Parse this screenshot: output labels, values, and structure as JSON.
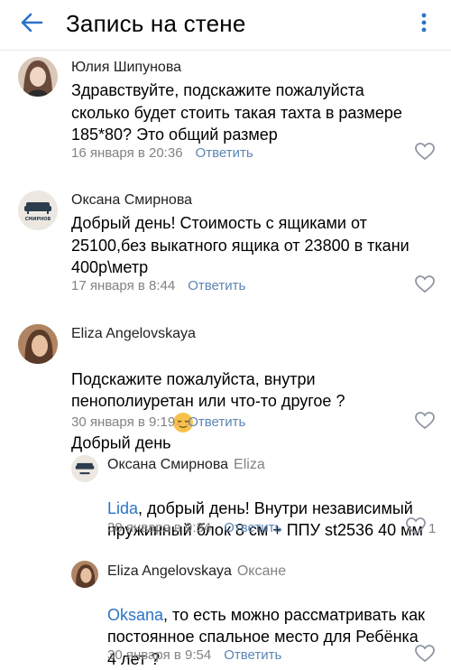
{
  "header": {
    "title": "Запись на стене",
    "back_icon": "arrow-left-icon",
    "more_icon": "vertical-dots-icon",
    "accent": "#2a73c6"
  },
  "comments": [
    {
      "author": "Юлия Шипунова",
      "text": "Здравствуйте, подскажите пожалуйста\nсколько будет стоить такая тахта в размере\n185*80? Это общий размер",
      "date": "16 января в 20:36",
      "reply_label": "Ответить"
    },
    {
      "author": "Оксана Смирнова",
      "avatar_text": "СМИРНОВ",
      "text": "Добрый день! Стоимость с ящиками от\n25100,без выкатного ящика от 23800 в ткани\n400р\\метр",
      "date": "17 января в 8:44",
      "reply_label": "Ответить"
    },
    {
      "author": "Eliza Angelovskaya",
      "text": "Подскажите пожалуйста, внутри\nпенополиуретан или что-то другое ?\nДобрый день",
      "date": "30 января в 9:19",
      "reply_label": "Ответить"
    },
    {
      "author": "Оксана Смирнова",
      "reply_to": "Eliza",
      "mention": "Lida",
      "text": ", добрый день! Внутри независимый\nпружинный блок 8 см + ППУ st2536 40 мм",
      "date": "30 января в 9:34",
      "reply_label": "Ответить",
      "likes": "1"
    },
    {
      "author": "Eliza Angelovskaya",
      "reply_to": "Оксане",
      "mention": "Oksana",
      "text": ", то есть можно рассматривать как\nпостоянное спальное место для Ребёнка\n4 лет ?",
      "date": "30 января в 9:54",
      "reply_label": "Ответить"
    }
  ]
}
